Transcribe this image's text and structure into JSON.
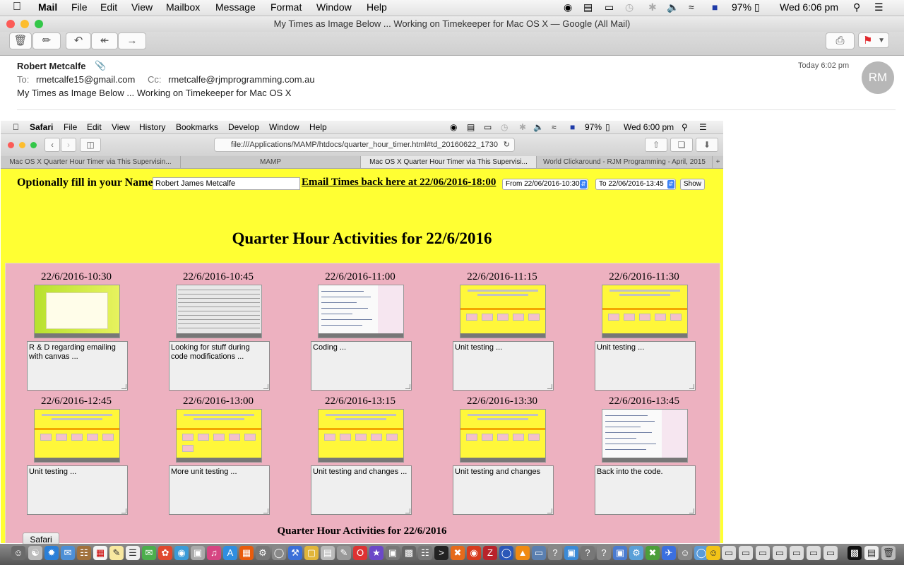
{
  "menubar": {
    "apple": "",
    "items": [
      "Mail",
      "File",
      "Edit",
      "View",
      "Mailbox",
      "Message",
      "Format",
      "Window",
      "Help"
    ],
    "battery": "97%",
    "clock": "Wed 6:06 pm"
  },
  "window": {
    "title": "My Times as Image Below ... Working on Timekeeper for Mac OS X — Google (All Mail)"
  },
  "message": {
    "from": "Robert Metcalfe",
    "to_label": "To:",
    "to": "rmetcalfe15@gmail.com",
    "cc_label": "Cc:",
    "cc": "rmetcalfe@rjmprogramming.com.au",
    "subject": "My Times as Image Below ... Working on Timekeeper for Mac OS X",
    "date": "Today 6:02 pm",
    "avatar": "RM"
  },
  "embedded": {
    "menubar": {
      "apple": "",
      "items": [
        "Safari",
        "File",
        "Edit",
        "View",
        "History",
        "Bookmarks",
        "Develop",
        "Window",
        "Help"
      ],
      "battery": "97%",
      "clock": "Wed 6:00 pm"
    },
    "url": "file:///Applications/MAMP/htdocs/quarter_hour_timer.html#td_20160622_1730",
    "tabs": [
      "Mac OS X Quarter Hour Timer via This Supervisin...",
      "MAMP",
      "Mac OS X Quarter Hour Timer via This Supervisi...",
      "World Clickaround - RJM Programming - April, 2015"
    ],
    "form": {
      "name_label": "Optionally fill in your Name:",
      "name_value": "Robert James Metcalfe",
      "email_link": "Email Times back here at 22/06/2016-18:00",
      "from_select": "From 22/06/2016-10:30",
      "to_select": "To 22/06/2016-13:45",
      "show_button": "Show"
    },
    "heading": "Quarter Hour Activities for 22/6/2016",
    "activities": [
      {
        "time": "22/6/2016-10:30",
        "note": "R & D regarding emailing with canvas ..."
      },
      {
        "time": "22/6/2016-10:45",
        "note": "Looking for stuff during code modifications ..."
      },
      {
        "time": "22/6/2016-11:00",
        "note": "Coding ..."
      },
      {
        "time": "22/6/2016-11:15",
        "note": "Unit testing ..."
      },
      {
        "time": "22/6/2016-11:30",
        "note": "Unit testing ..."
      },
      {
        "time": "22/6/2016-12:45",
        "note": "Unit testing ..."
      },
      {
        "time": "22/6/2016-13:00",
        "note": "More unit testing ..."
      },
      {
        "time": "22/6/2016-13:15",
        "note": "Unit testing and changes ..."
      },
      {
        "time": "22/6/2016-13:30",
        "note": "Unit testing and changes"
      },
      {
        "time": "22/6/2016-13:45",
        "note": "Back into the code."
      }
    ],
    "footer_heading": "Quarter Hour Activities for 22/6/2016"
  },
  "dock_label": "Safari",
  "colors": {
    "page_yellow": "#ffff33",
    "grid_pink": "#edb1c0",
    "flag_red": "#e0272c"
  }
}
